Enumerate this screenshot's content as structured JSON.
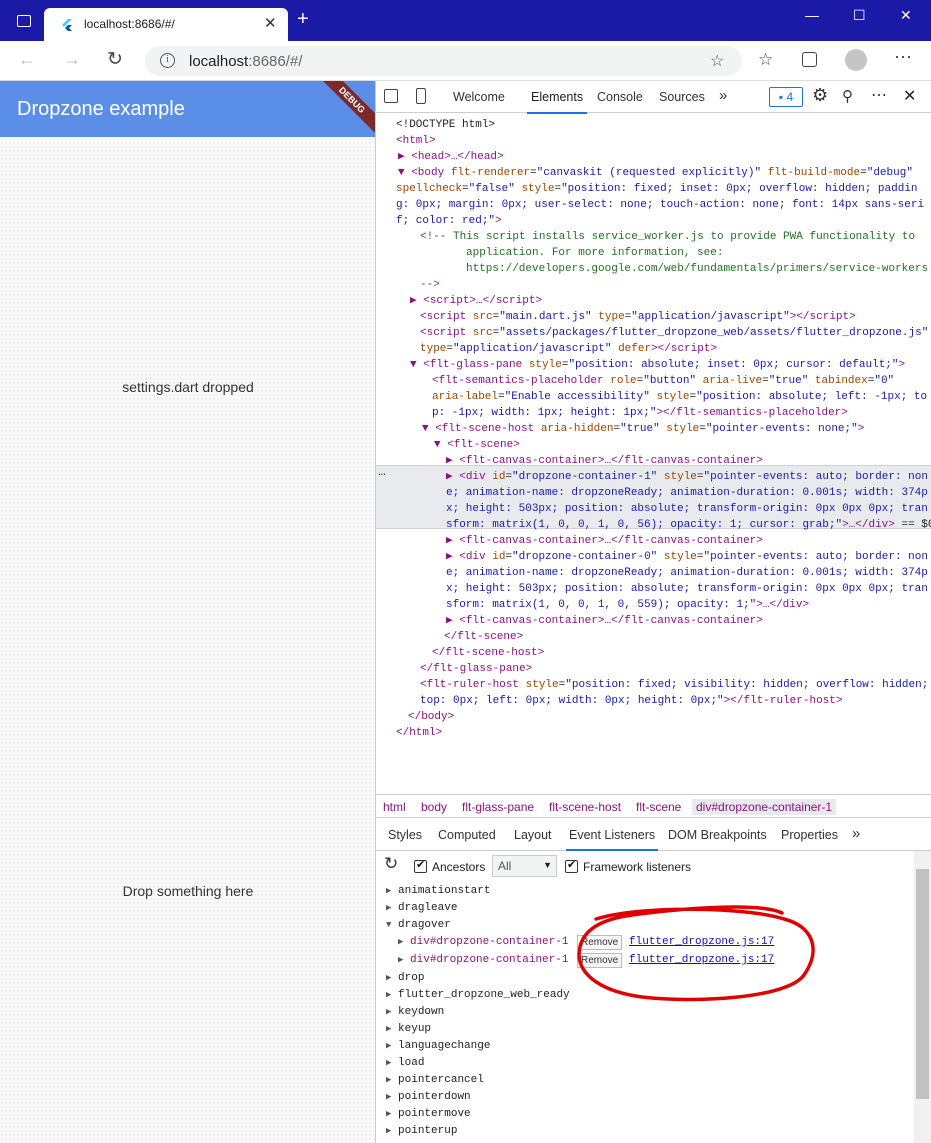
{
  "browser": {
    "tab_title": "localhost:8686/#/",
    "url_host": "localhost",
    "url_rest": ":8686/#/",
    "new_tab": "+",
    "tab_close": "✕",
    "window_controls": [
      "—",
      "☐",
      "✕"
    ]
  },
  "app": {
    "title": "Dropzone example",
    "debug_banner": "DEBUG",
    "dropped_text": "settings.dart dropped",
    "drop_hint": "Drop something here"
  },
  "devtools": {
    "tabs": [
      "Welcome",
      "Elements",
      "Console",
      "Sources"
    ],
    "more_tabs": "»",
    "active_tab": "Elements",
    "issues_count": "4",
    "dom_lines": [
      {
        "ind": 20,
        "html": "<span class=\"tx\">&lt;!DOCTYPE html&gt;</span>"
      },
      {
        "ind": 20,
        "html": "<span class=\"tg\">&lt;html&gt;</span>"
      },
      {
        "ind": 22,
        "html": "<span class=\"tg\">▶ &lt;head&gt;…&lt;/head&gt;</span>"
      },
      {
        "ind": 22,
        "html": "<span class=\"tg\">▼ &lt;body </span><span class=\"an\">flt-renderer</span>=<span class=\"av\">\"canvaskit (requested explicitly)\"</span> <span class=\"an\">flt-build-mode</span>=<span class=\"av\">\"debug\"</span>"
      },
      {
        "ind": 20,
        "html": "<span class=\"an\">spellcheck</span>=<span class=\"av\">\"false\"</span> <span class=\"an\">style</span>=<span class=\"av\">\"position: fixed; inset: 0px; overflow: hidden; paddin</span>"
      },
      {
        "ind": 20,
        "html": "<span class=\"av\">g: 0px; margin: 0px; user-select: none; touch-action: none; font: 14px sans-seri</span>"
      },
      {
        "ind": 20,
        "html": "<span class=\"av\">f; color: red;\"</span><span class=\"tg\">&gt;</span>"
      },
      {
        "ind": 44,
        "html": "<span class=\"cm\">&lt;!-- This script installs service_worker.js to provide PWA functionality to</span>"
      },
      {
        "ind": 90,
        "html": "<span class=\"cm\">application. For more information, see:</span>"
      },
      {
        "ind": 90,
        "html": "<span class=\"cm\">https://developers.google.com/web/fundamentals/primers/service-workers</span>"
      },
      {
        "ind": 44,
        "html": "<span class=\"cm\">--&gt;</span>"
      },
      {
        "ind": 34,
        "html": "<span class=\"tg\">▶ &lt;script&gt;…&lt;/script&gt;</span>"
      },
      {
        "ind": 44,
        "html": "<span class=\"tg\">&lt;script </span><span class=\"an\">src</span>=<span class=\"av\">\"main.dart.js\"</span> <span class=\"an\">type</span>=<span class=\"av\">\"application/javascript\"</span><span class=\"tg\">&gt;&lt;/script&gt;</span>"
      },
      {
        "ind": 44,
        "html": "<span class=\"tg\">&lt;script </span><span class=\"an\">src</span>=<span class=\"av\">\"assets/packages/flutter_dropzone_web/assets/flutter_dropzone.js\"</span>"
      },
      {
        "ind": 44,
        "html": "<span class=\"an\">type</span>=<span class=\"av\">\"application/javascript\"</span> <span class=\"an\">defer</span><span class=\"tg\">&gt;&lt;/script&gt;</span>"
      },
      {
        "ind": 34,
        "html": "<span class=\"tg\">▼ &lt;flt-glass-pane </span><span class=\"an\">style</span>=<span class=\"av\">\"position: absolute; inset: 0px; cursor: default;\"</span><span class=\"tg\">&gt;</span>"
      },
      {
        "ind": 56,
        "html": "<span class=\"tg\">&lt;flt-semantics-placeholder </span><span class=\"an\">role</span>=<span class=\"av\">\"button\"</span> <span class=\"an\">aria-live</span>=<span class=\"av\">\"true\"</span> <span class=\"an\">tabindex</span>=<span class=\"av\">\"0\"</span>"
      },
      {
        "ind": 56,
        "html": "<span class=\"an\">aria-label</span>=<span class=\"av\">\"Enable accessibility\"</span> <span class=\"an\">style</span>=<span class=\"av\">\"position: absolute; left: -1px; to</span>"
      },
      {
        "ind": 56,
        "html": "<span class=\"av\">p: -1px; width: 1px; height: 1px;\"</span><span class=\"tg\">&gt;&lt;/flt-semantics-placeholder&gt;</span>"
      },
      {
        "ind": 46,
        "html": "<span class=\"tg\">▼ &lt;flt-scene-host </span><span class=\"an\">aria-hidden</span>=<span class=\"av\">\"true\"</span> <span class=\"an\">style</span>=<span class=\"av\">\"pointer-events: none;\"</span><span class=\"tg\">&gt;</span>"
      },
      {
        "ind": 58,
        "html": "<span class=\"tg\">▼ &lt;flt-scene&gt;</span>"
      },
      {
        "ind": 70,
        "html": "<span class=\"tg\">▶ &lt;flt-canvas-container&gt;…&lt;/flt-canvas-container&gt;</span>"
      },
      {
        "ind": 70,
        "html": "<span class=\"tg\">▶ &lt;div </span><span class=\"an\">id</span>=<span class=\"av\">\"dropzone-container-1\"</span> <span class=\"an\">style</span>=<span class=\"av\">\"pointer-events: auto; border: non</span>"
      },
      {
        "ind": 70,
        "html": "<span class=\"av\">e; animation-name: dropzoneReady; animation-duration: 0.001s; width: 374p</span>"
      },
      {
        "ind": 70,
        "html": "<span class=\"av\">x; height: 503px; position: absolute; transform-origin: 0px 0px 0px; tran</span>"
      },
      {
        "ind": 70,
        "html": "<span class=\"av\">sform: matrix(1, 0, 0, 1, 0, 56); opacity: 1; cursor: grab;\"</span><span class=\"tg\">&gt;…&lt;/div&gt;</span> <span class=\"tx\">== $0</span>"
      },
      {
        "ind": 70,
        "html": "<span class=\"tg\">▶ &lt;flt-canvas-container&gt;…&lt;/flt-canvas-container&gt;</span>"
      },
      {
        "ind": 70,
        "html": "<span class=\"tg\">▶ &lt;div </span><span class=\"an\">id</span>=<span class=\"av\">\"dropzone-container-0\"</span> <span class=\"an\">style</span>=<span class=\"av\">\"pointer-events: auto; border: non</span>"
      },
      {
        "ind": 70,
        "html": "<span class=\"av\">e; animation-name: dropzoneReady; animation-duration: 0.001s; width: 374p</span>"
      },
      {
        "ind": 70,
        "html": "<span class=\"av\">x; height: 503px; position: absolute; transform-origin: 0px 0px 0px; tran</span>"
      },
      {
        "ind": 70,
        "html": "<span class=\"av\">sform: matrix(1, 0, 0, 1, 0, 559); opacity: 1;\"</span><span class=\"tg\">&gt;…&lt;/div&gt;</span>"
      },
      {
        "ind": 70,
        "html": "<span class=\"tg\">▶ &lt;flt-canvas-container&gt;…&lt;/flt-canvas-container&gt;</span>"
      },
      {
        "ind": 68,
        "html": "<span class=\"tg\">&lt;/flt-scene&gt;</span>"
      },
      {
        "ind": 56,
        "html": "<span class=\"tg\">&lt;/flt-scene-host&gt;</span>"
      },
      {
        "ind": 44,
        "html": "<span class=\"tg\">&lt;/flt-glass-pane&gt;</span>"
      },
      {
        "ind": 44,
        "html": "<span class=\"tg\">&lt;flt-ruler-host </span><span class=\"an\">style</span>=<span class=\"av\">\"position: fixed; visibility: hidden; overflow: hidden;</span>"
      },
      {
        "ind": 44,
        "html": "<span class=\"av\">top: 0px; left: 0px; width: 0px; height: 0px;\"</span><span class=\"tg\">&gt;&lt;/flt-ruler-host&gt;</span>"
      },
      {
        "ind": 32,
        "html": "<span class=\"tg\">&lt;/body&gt;</span>"
      },
      {
        "ind": 20,
        "html": "<span class=\"tg\">&lt;/html&gt;</span>"
      }
    ],
    "selection_dots": "…",
    "breadcrumbs": [
      "html",
      "body",
      "flt-glass-pane",
      "flt-scene-host",
      "flt-scene",
      "div#dropzone-container-1"
    ],
    "subtabs": [
      "Styles",
      "Computed",
      "Layout",
      "Event Listeners",
      "DOM Breakpoints",
      "Properties"
    ],
    "active_subtab": "Event Listeners",
    "ancestors_label": "Ancestors",
    "filter_value": "All",
    "framework_label": "Framework listeners",
    "events": [
      {
        "name": "animationstart",
        "expanded": false
      },
      {
        "name": "dragleave",
        "expanded": false
      },
      {
        "name": "dragover",
        "expanded": true
      },
      {
        "name": "drop",
        "expanded": false
      },
      {
        "name": "flutter_dropzone_web_ready",
        "expanded": false
      },
      {
        "name": "keydown",
        "expanded": false
      },
      {
        "name": "keyup",
        "expanded": false
      },
      {
        "name": "languagechange",
        "expanded": false
      },
      {
        "name": "load",
        "expanded": false
      },
      {
        "name": "pointercancel",
        "expanded": false
      },
      {
        "name": "pointerdown",
        "expanded": false
      },
      {
        "name": "pointermove",
        "expanded": false
      },
      {
        "name": "pointerup",
        "expanded": false
      }
    ],
    "dragover_listeners": [
      {
        "node": "div#dropzone-container-1",
        "remove": "Remove",
        "source": "flutter_dropzone.js:17"
      },
      {
        "node": "div#dropzone-container-1",
        "remove": "Remove",
        "source": "flutter_dropzone.js:17"
      }
    ]
  },
  "colors": {
    "titlebar": "#1a1aa6",
    "appbar": "#5b8ee6",
    "annotation_circle": "#e00000"
  }
}
